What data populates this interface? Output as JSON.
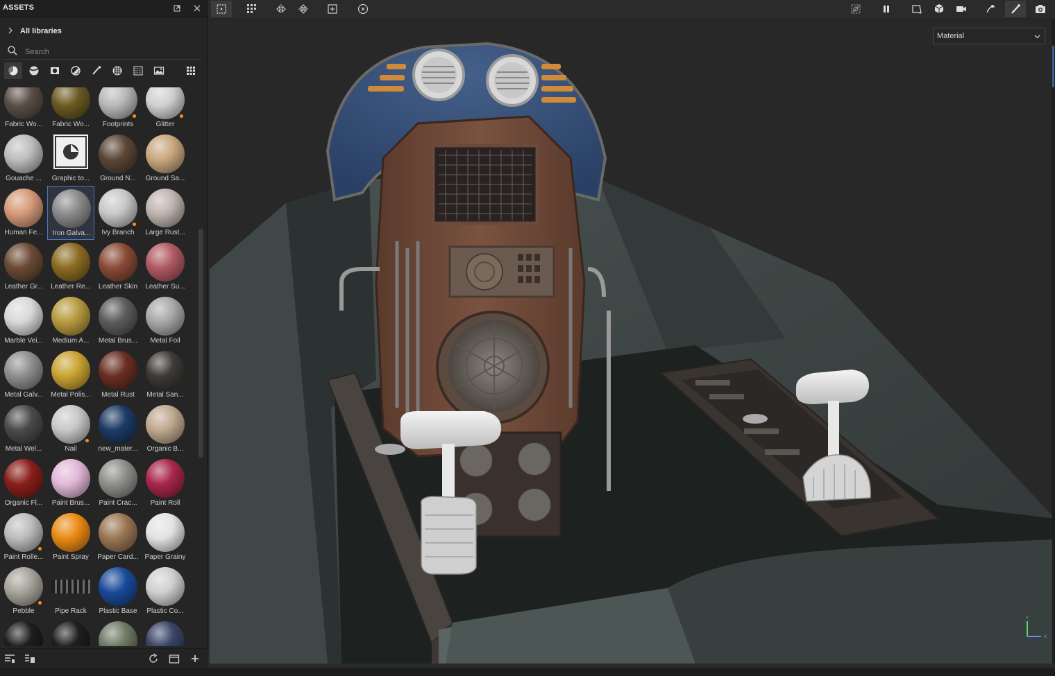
{
  "assets_panel": {
    "title": "ASSETS",
    "breadcrumb": "All libraries",
    "search": {
      "placeholder": "Search",
      "value": ""
    },
    "filters": [
      {
        "icon": "material-sphere-icon",
        "active": true
      },
      {
        "icon": "smart-material-icon",
        "active": false
      },
      {
        "icon": "smart-mask-icon",
        "active": false
      },
      {
        "icon": "filter-icon",
        "active": false
      },
      {
        "icon": "brush-icon",
        "active": false
      },
      {
        "icon": "texture-checker-icon",
        "active": false
      },
      {
        "icon": "procedural-pattern-icon",
        "active": false
      },
      {
        "icon": "environment-image-icon",
        "active": false
      },
      {
        "icon": "grid-view-icon",
        "active": false
      }
    ],
    "materials": [
      {
        "label": "Fabric Wo...",
        "color": "#5a4e46",
        "badge": false
      },
      {
        "label": "Fabric Wo...",
        "color": "#6b5a22",
        "badge": false
      },
      {
        "label": "Footprints",
        "color": "#b8b8b8",
        "badge": true
      },
      {
        "label": "Glitter",
        "color": "#cfcfcf",
        "badge": true
      },
      {
        "label": "Gouache ...",
        "color": "#bdbdbd",
        "badge": false
      },
      {
        "label": "Graphic to...",
        "color": "#e8e8e8",
        "badge": false,
        "graphic": true
      },
      {
        "label": "Ground N...",
        "color": "#5b4636",
        "badge": false
      },
      {
        "label": "Ground Sa...",
        "color": "#c9a77e",
        "badge": false
      },
      {
        "label": "Human Fe...",
        "color": "#d59a78",
        "badge": false
      },
      {
        "label": "Iron Galva...",
        "color": "#8a8a8a",
        "badge": false,
        "selected": true
      },
      {
        "label": "Ivy Branch",
        "color": "#c8c8c8",
        "badge": true
      },
      {
        "label": "Large Rust...",
        "color": "#bfb3ae",
        "badge": false
      },
      {
        "label": "Leather Gr...",
        "color": "#6b4a34",
        "badge": false
      },
      {
        "label": "Leather Re...",
        "color": "#8a6b22",
        "badge": false
      },
      {
        "label": "Leather Skin",
        "color": "#8a4a36",
        "badge": false
      },
      {
        "label": "Leather Su...",
        "color": "#b05a62",
        "badge": false
      },
      {
        "label": "Marble Vei...",
        "color": "#d8d8d8",
        "badge": false
      },
      {
        "label": "Medium A...",
        "color": "#b89a40",
        "badge": false
      },
      {
        "label": "Metal Brus...",
        "color": "#5c5c5c",
        "badge": false
      },
      {
        "label": "Metal Foil",
        "color": "#a8a8a8",
        "badge": false
      },
      {
        "label": "Metal Galv...",
        "color": "#8e8e8e",
        "badge": false
      },
      {
        "label": "Metal Polis...",
        "color": "#c9a332",
        "badge": false
      },
      {
        "label": "Metal Rust",
        "color": "#6a2e22",
        "badge": false
      },
      {
        "label": "Metal San...",
        "color": "#3e3a36",
        "badge": false
      },
      {
        "label": "Metal Wel...",
        "color": "#4a4a4a",
        "badge": false
      },
      {
        "label": "Nail",
        "color": "#c8c8c8",
        "badge": true
      },
      {
        "label": "new_mater...",
        "color": "#1d3a66",
        "badge": false
      },
      {
        "label": "Organic B...",
        "color": "#bfa88e",
        "badge": false
      },
      {
        "label": "Organic Fl...",
        "color": "#8a1e1a",
        "badge": false
      },
      {
        "label": "Paint Brus...",
        "color": "#e2b8d8",
        "badge": false
      },
      {
        "label": "Paint Crac...",
        "color": "#8e8e8a",
        "badge": false
      },
      {
        "label": "Paint Roll",
        "color": "#a8264a",
        "badge": false
      },
      {
        "label": "Paint Rolle...",
        "color": "#bcbcbc",
        "badge": true
      },
      {
        "label": "Paint Spray",
        "color": "#ea8a14",
        "badge": false
      },
      {
        "label": "Paper Card...",
        "color": "#9a7654",
        "badge": false
      },
      {
        "label": "Paper Grainy",
        "color": "#e2e2e2",
        "badge": false
      },
      {
        "label": "Pebble",
        "color": "#a6a39a",
        "badge": true
      },
      {
        "label": "Pipe Rack",
        "color": "#2a2a2a",
        "badge": false,
        "rack": true
      },
      {
        "label": "Plastic Base",
        "color": "#1a4a9a",
        "badge": false
      },
      {
        "label": "Plastic Co...",
        "color": "#cfcfcf",
        "badge": false
      },
      {
        "label": "",
        "color": "#1e1e1e",
        "badge": false
      },
      {
        "label": "",
        "color": "#1e1e1e",
        "badge": false
      },
      {
        "label": "",
        "color": "#6e7a66",
        "badge": false
      },
      {
        "label": "",
        "color": "#3a4466",
        "badge": false
      }
    ]
  },
  "viewport": {
    "display_mode": "Material"
  },
  "colors": {
    "accent": "#4a78c4",
    "badge": "#ff8c1a",
    "panel_bg": "#252525",
    "viewport_bg": "#282828"
  }
}
